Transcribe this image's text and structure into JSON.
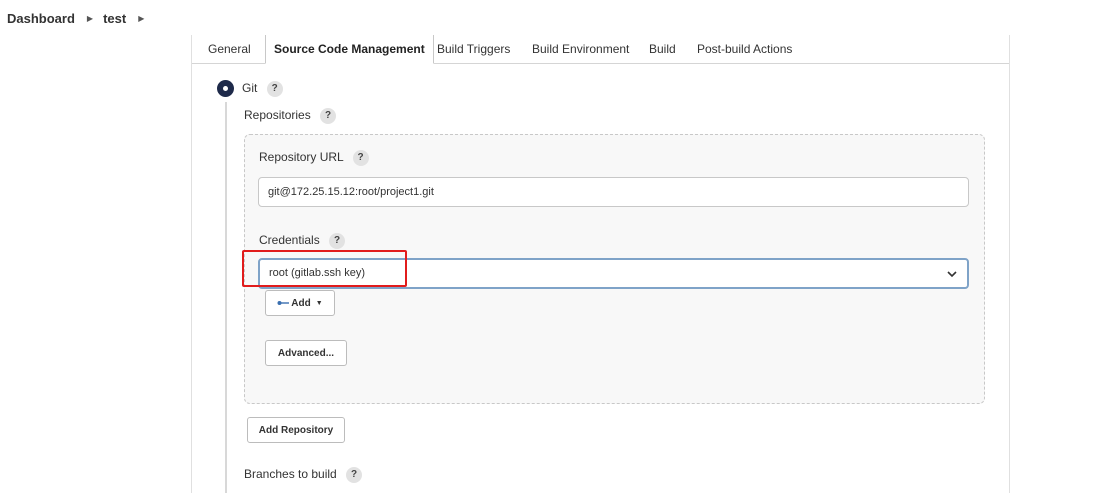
{
  "breadcrumb": {
    "items": [
      {
        "label": "Dashboard"
      },
      {
        "label": "test"
      }
    ]
  },
  "tabs": [
    {
      "label": "General",
      "active": false
    },
    {
      "label": "Source Code Management",
      "active": true
    },
    {
      "label": "Build Triggers",
      "active": false
    },
    {
      "label": "Build Environment",
      "active": false
    },
    {
      "label": "Build",
      "active": false
    },
    {
      "label": "Post-build Actions",
      "active": false
    }
  ],
  "help_glyph": "?",
  "scm": {
    "git_label": "Git",
    "git_selected": true,
    "repositories_label": "Repositories",
    "repository_url_label": "Repository URL",
    "repository_url_value": "git@172.25.15.12:root/project1.git",
    "credentials_label": "Credentials",
    "credentials_selected": "root (gitlab.ssh key)",
    "add_label": "Add",
    "advanced_label": "Advanced...",
    "add_repository_label": "Add Repository",
    "branches_label": "Branches to build"
  },
  "colors": {
    "highlight": "#e11c1c",
    "focus_border": "#7fa3c8",
    "radio": "#1e2a4a"
  }
}
